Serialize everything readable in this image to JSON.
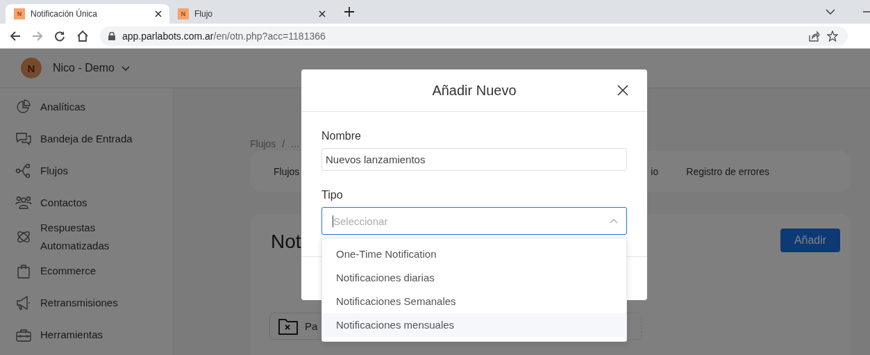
{
  "browser": {
    "tabs": [
      {
        "title": "Notificación Única",
        "favicon": "N",
        "selected": true
      },
      {
        "title": "Flujo",
        "favicon": "N",
        "selected": false
      }
    ],
    "url": {
      "host": "app.parlabots.com.ar",
      "path": "/en/otn.php?acc=1181366"
    }
  },
  "app": {
    "account": {
      "initial": "N",
      "name": "Nico - Demo"
    },
    "sidebar": {
      "items": [
        {
          "label": "Analíticas",
          "kind": "pie"
        },
        {
          "label": "Bandeja de Entrada",
          "kind": "chat"
        },
        {
          "label": "Flujos",
          "kind": "flow"
        },
        {
          "label": "Contactos",
          "kind": "people"
        },
        {
          "label": "Respuestas Automatizadas",
          "kind": "atom"
        },
        {
          "label": "Ecommerce",
          "kind": "bag"
        },
        {
          "label": "Retransmisiones",
          "kind": "megaphone"
        },
        {
          "label": "Herramientas",
          "kind": "toolbox"
        }
      ]
    },
    "breadcrumb": {
      "items": [
        "Flujos",
        "..."
      ],
      "separator": "/"
    },
    "tabs": [
      {
        "label": "Flujos"
      },
      {
        "label": "io"
      },
      {
        "label": "Registro de errores"
      }
    ],
    "page_title": "Not",
    "add_button": "Añadir",
    "folder_card": "Pa"
  },
  "modal": {
    "title": "Añadir Nuevo",
    "name_field": {
      "label": "Nombre",
      "value": "Nuevos lanzamientos"
    },
    "type_field": {
      "label": "Tipo",
      "placeholder": "Seleccionar",
      "expanded": true
    },
    "options": [
      {
        "label": "One-Time Notification",
        "hovered": false
      },
      {
        "label": "Notificaciones diarias",
        "hovered": false
      },
      {
        "label": "Notificaciones Semanales",
        "hovered": false
      },
      {
        "label": "Notificaciones mensuales",
        "hovered": true
      }
    ]
  }
}
